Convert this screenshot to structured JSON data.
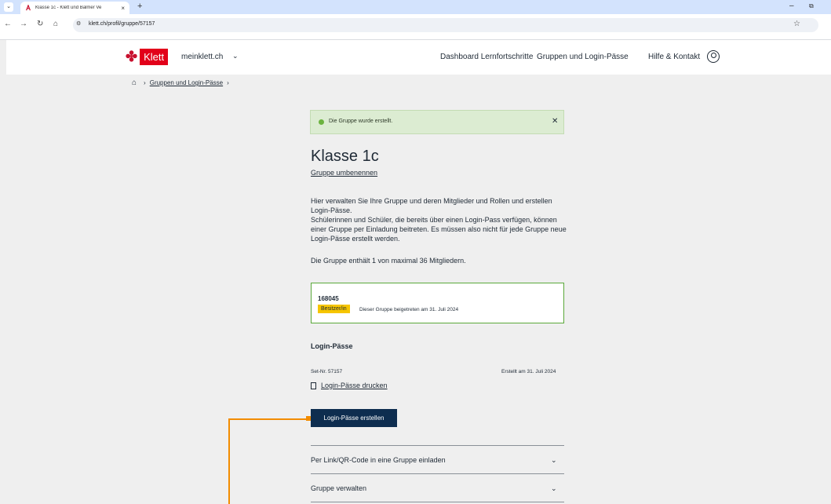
{
  "browser": {
    "tab_menu_icon": "chevron-down-icon",
    "tab_title": "Klasse 1c - Klett und Balmer Ve",
    "tab_close": "×",
    "new_tab": "+",
    "minimize": "–",
    "maximize": "⧉",
    "url": "klett.ch/profil/gruppe/57157"
  },
  "header": {
    "logo_text": "Klett",
    "site_name": "meinklett.ch",
    "nav": [
      "Dashboard Lernfortschritte",
      "Gruppen und Login-Pässe",
      "Hilfe & Kontakt"
    ]
  },
  "breadcrumb": {
    "items": [
      "Gruppen und Login-Pässe"
    ]
  },
  "alert": {
    "text": "Die Gruppe wurde erstellt.",
    "status_color": "#6cb33f"
  },
  "group": {
    "title": "Klasse 1c",
    "rename_link": "Gruppe umbenennen",
    "description": [
      "Hier verwalten Sie Ihre Gruppe und deren Mitglieder und Rollen und erstellen Login-Pässe.",
      "Schülerinnen und Schüler, die bereits über einen Login-Pass verfügen, können einer Gruppe per Einladung beitreten. Es müssen also nicht für jede Gruppe neue Login-Pässe erstellt werden."
    ],
    "member_count": "Die Gruppe enthält 1 von maximal 36 Mitgliedern."
  },
  "member": {
    "id": "168045",
    "role": "Besitzer/in",
    "joined": "Dieser Gruppe beigetreten am 31. Juli 2024"
  },
  "login_passes": {
    "title": "Login-Pässe",
    "set_nr": "Set-Nr. 57157",
    "created": "Erstellt am 31. Juli 2024",
    "print_link": "Login-Pässe drucken",
    "create_button": "Login-Pässe erstellen"
  },
  "accordion": [
    "Per Link/QR-Code in eine Gruppe einladen",
    "Gruppe verwalten"
  ],
  "colors": {
    "accent": "#0e2d4f",
    "brand": "#e2001a",
    "annotation": "#f28c00"
  }
}
